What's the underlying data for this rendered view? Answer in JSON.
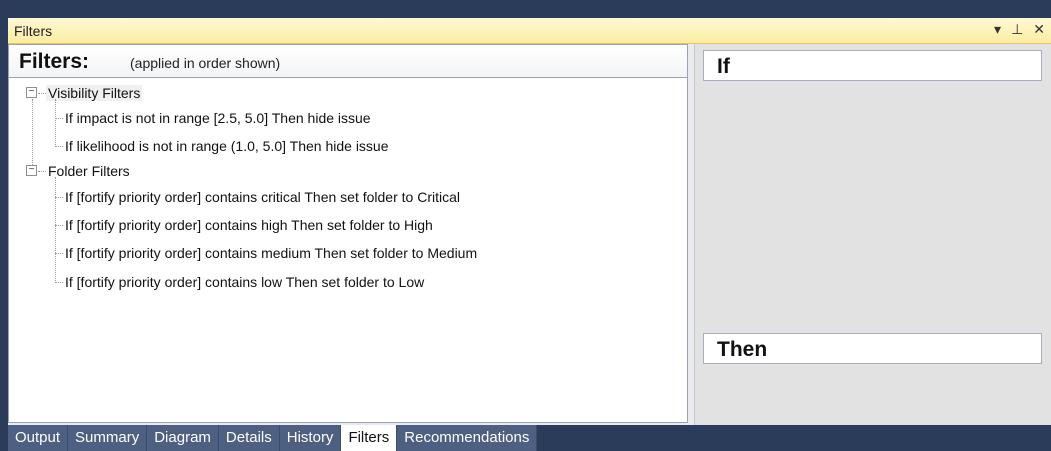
{
  "panel": {
    "title": "Filters",
    "dropdown_glyph": "▾",
    "pin_glyph": "⊥",
    "close_glyph": "✕"
  },
  "left": {
    "heading": "Filters:",
    "subheading": "(applied in order shown)"
  },
  "tree": {
    "groups": [
      {
        "label": "Visibility Filters",
        "items": [
          "If impact is not in range [2.5, 5.0] Then hide issue",
          "If likelihood is not in range (1.0, 5.0] Then hide issue"
        ]
      },
      {
        "label": "Folder Filters",
        "items": [
          "If [fortify priority order] contains critical Then set folder to Critical",
          "If [fortify priority order] contains high Then set folder to High",
          "If [fortify priority order] contains medium Then set folder to Medium",
          "If [fortify priority order] contains low Then set folder to Low"
        ]
      }
    ]
  },
  "right": {
    "if_label": "If",
    "then_label": "Then"
  },
  "tabs": [
    "Output",
    "Summary",
    "Diagram",
    "Details",
    "History",
    "Filters",
    "Recommendations"
  ],
  "active_tab": "Filters",
  "colors": {
    "title_bar": "#fbeda0",
    "tab_bar": "#4d6082",
    "frame": "#2b3c5b"
  }
}
